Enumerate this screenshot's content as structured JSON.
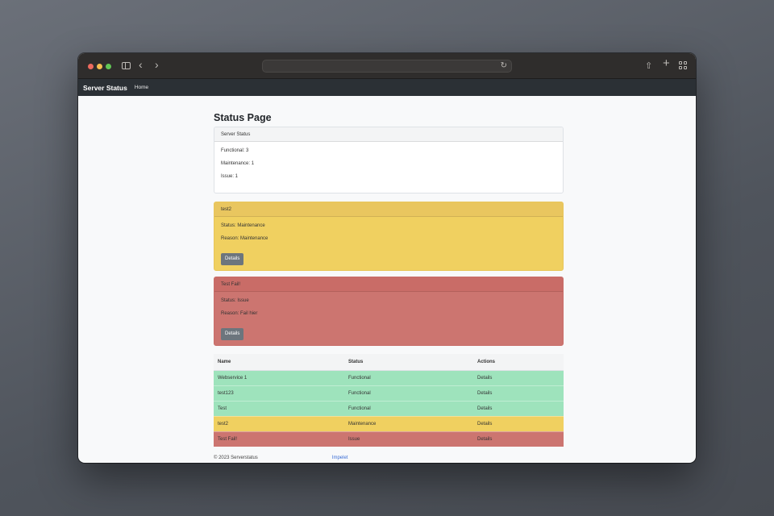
{
  "navbar": {
    "brand": "Server Status",
    "home": "Home"
  },
  "page": {
    "title": "Status Page"
  },
  "summary": {
    "header": "Server Status",
    "functional": "Functional: 3",
    "maintenance": "Maintenance: 1",
    "issue": "Issue: 1"
  },
  "alerts": [
    {
      "title": "test2",
      "status": "Status: Maintenance",
      "reason": "Reason: Maintenance",
      "button": "Details"
    },
    {
      "title": "Test Fail!",
      "status": "Status: Issue",
      "reason": "Reason: Fail hier",
      "button": "Details"
    }
  ],
  "table": {
    "headers": [
      "Name",
      "Status",
      "Actions"
    ],
    "rows": [
      {
        "name": "Webservice 1",
        "status": "Functional",
        "action": "Details"
      },
      {
        "name": "test123",
        "status": "Functional",
        "action": "Details"
      },
      {
        "name": "Test",
        "status": "Functional",
        "action": "Details"
      },
      {
        "name": "test2",
        "status": "Maintenance",
        "action": "Details"
      },
      {
        "name": "Test Fail!",
        "status": "Issue",
        "action": "Details"
      }
    ]
  },
  "footer": {
    "copyright": "© 2023 Serverstatus",
    "imprint": "Impelet"
  },
  "colors": {
    "functional": "#9ee3bc",
    "maintenance": "#f0d060",
    "issue": "#cc7570",
    "navbar": "#2b3035"
  },
  "icons": [
    "sidebar-icon",
    "back-icon",
    "forward-icon",
    "reload-icon",
    "share-icon",
    "plus-icon",
    "tabs-icon"
  ]
}
